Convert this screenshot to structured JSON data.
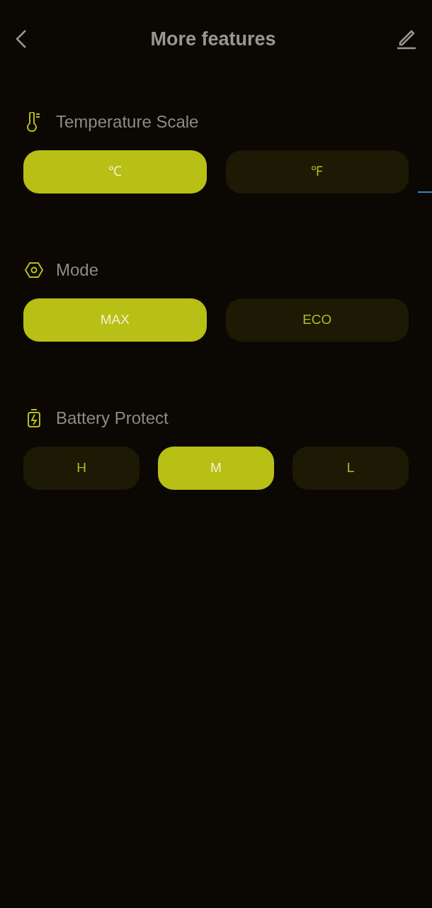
{
  "header": {
    "title": "More features"
  },
  "sections": [
    {
      "kind": "thermometer",
      "label": "Temperature Scale",
      "options": [
        {
          "label": "℃",
          "selected": true
        },
        {
          "label": "℉",
          "selected": false
        }
      ]
    },
    {
      "kind": "hexagon",
      "label": "Mode",
      "options": [
        {
          "label": "MAX",
          "selected": true
        },
        {
          "label": "ECO",
          "selected": false
        }
      ]
    },
    {
      "kind": "battery",
      "label": "Battery Protect",
      "options": [
        {
          "label": "H",
          "selected": false
        },
        {
          "label": "M",
          "selected": true
        },
        {
          "label": "L",
          "selected": false
        }
      ]
    }
  ]
}
